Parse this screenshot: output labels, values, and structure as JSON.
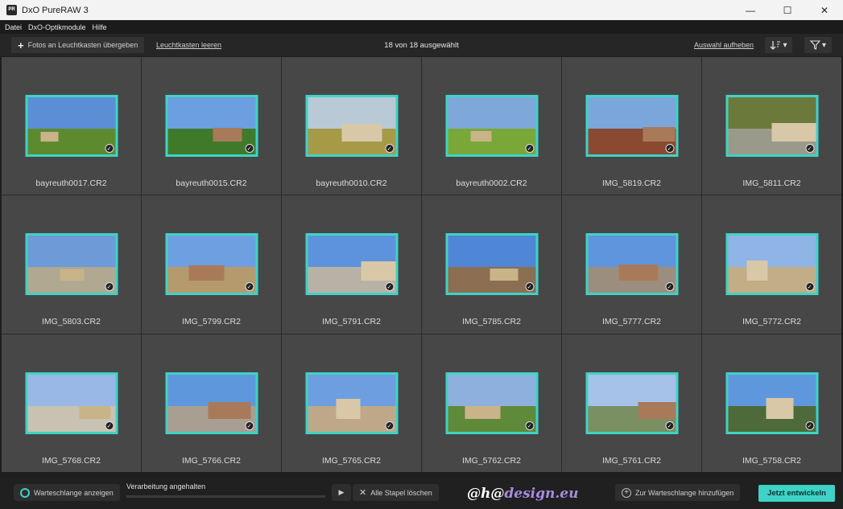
{
  "window": {
    "title": "DxO PureRAW 3",
    "logo": "PR",
    "minimize": "—",
    "maximize": "☐",
    "close": "✕"
  },
  "menu": [
    "Datei",
    "DxO-Optikmodule",
    "Hilfe"
  ],
  "toolbar": {
    "transfer_label": "Fotos an Leuchtkasten übergeben",
    "clear_label": "Leuchtkasten leeren",
    "selection_status": "18 von 18 ausgewählt",
    "deselect_label": "Auswahl aufheben",
    "sort_icon": "sort-icon",
    "filter_icon": "filter-icon"
  },
  "photos": [
    {
      "name": "bayreuth0017.CR2",
      "sky": "#5a8fd6",
      "ground": "#5d8a2e"
    },
    {
      "name": "bayreuth0015.CR2",
      "sky": "#6b9fe0",
      "ground": "#3f7a2a"
    },
    {
      "name": "bayreuth0010.CR2",
      "sky": "#b9c9d6",
      "ground": "#a69a47"
    },
    {
      "name": "bayreuth0002.CR2",
      "sky": "#7ea8d9",
      "ground": "#79a838"
    },
    {
      "name": "IMG_5819.CR2",
      "sky": "#7aa6dc",
      "ground": "#8a4a32"
    },
    {
      "name": "IMG_5811.CR2",
      "sky": "#6b7a3a",
      "ground": "#9a9a8a"
    },
    {
      "name": "IMG_5803.CR2",
      "sky": "#6f9ad8",
      "ground": "#b0a890"
    },
    {
      "name": "IMG_5799.CR2",
      "sky": "#6e9fe0",
      "ground": "#b59a6e"
    },
    {
      "name": "IMG_5791.CR2",
      "sky": "#5d93dc",
      "ground": "#b8b2a6"
    },
    {
      "name": "IMG_5785.CR2",
      "sky": "#4f86d6",
      "ground": "#8c6e52"
    },
    {
      "name": "IMG_5777.CR2",
      "sky": "#5f95dc",
      "ground": "#9c8e7e"
    },
    {
      "name": "IMG_5772.CR2",
      "sky": "#8fb4e6",
      "ground": "#c2ad86"
    },
    {
      "name": "IMG_5768.CR2",
      "sky": "#9ab8e6",
      "ground": "#c9c2b2"
    },
    {
      "name": "IMG_5766.CR2",
      "sky": "#5f97dc",
      "ground": "#a89e92"
    },
    {
      "name": "IMG_5765.CR2",
      "sky": "#6d9fe0",
      "ground": "#bfa88a"
    },
    {
      "name": "IMG_5762.CR2",
      "sky": "#8eb0dc",
      "ground": "#5f8a3a"
    },
    {
      "name": "IMG_5761.CR2",
      "sky": "#a6c2e8",
      "ground": "#7a8f62"
    },
    {
      "name": "IMG_5758.CR2",
      "sky": "#5f97dc",
      "ground": "#4f6a3a"
    }
  ],
  "bottom": {
    "queue_label": "Warteschlange anzeigen",
    "status_label": "Verarbeitung angehalten",
    "progress": 0,
    "play_icon": "▶",
    "clear_stacks_label": "Alle Stapel löschen",
    "clear_icon": "✕",
    "watermark_a": "@h@",
    "watermark_b": "design.eu",
    "add_queue_label": "Zur Warteschlange hinzufügen",
    "develop_label": "Jetzt entwickeln"
  }
}
